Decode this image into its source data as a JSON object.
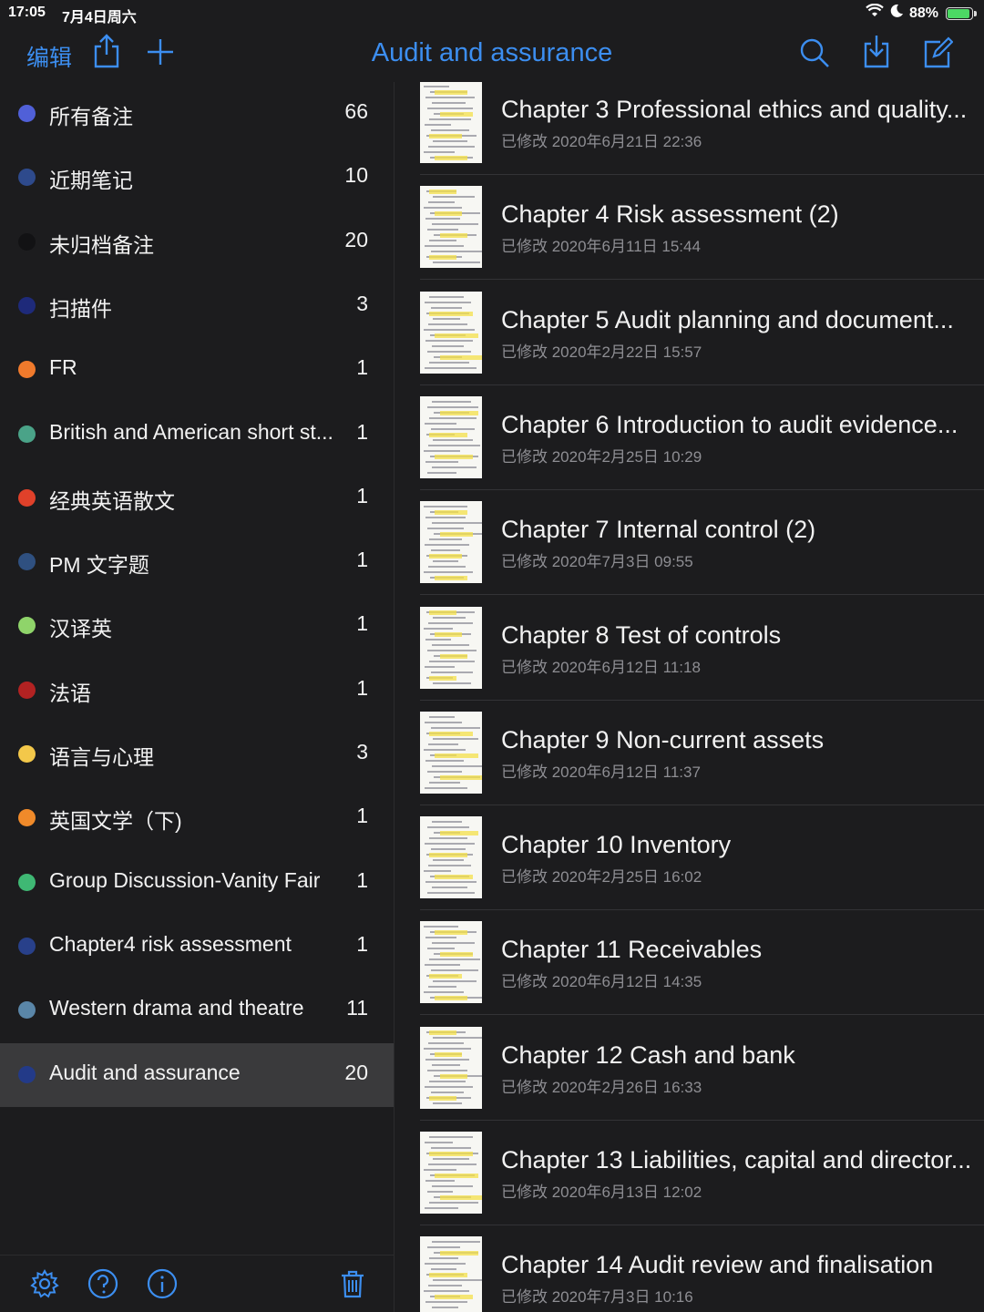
{
  "status_bar": {
    "time": "17:05",
    "date": "7月4日周六",
    "battery": "88%"
  },
  "toolbar": {
    "edit_label": "编辑",
    "title": "Audit and assurance",
    "accent": "#3c8ef0"
  },
  "sidebar": {
    "notebooks": [
      {
        "label": "所有备注",
        "count": "66",
        "color": "#5060d8"
      },
      {
        "label": "近期笔记",
        "count": "10",
        "color": "#2e4a8c"
      },
      {
        "label": "未归档备注",
        "count": "20",
        "color": "#121214"
      },
      {
        "label": "扫描件",
        "count": "3",
        "color": "#1e2a7a"
      },
      {
        "label": "FR",
        "count": "1",
        "color": "#f07a2c"
      },
      {
        "label": "British and American short st...",
        "count": "1",
        "color": "#4aa388"
      },
      {
        "label": "经典英语散文",
        "count": "1",
        "color": "#e0412a"
      },
      {
        "label": "PM 文字题",
        "count": "1",
        "color": "#2f5080"
      },
      {
        "label": "汉译英",
        "count": "1",
        "color": "#8fd46a"
      },
      {
        "label": "法语",
        "count": "1",
        "color": "#b22222"
      },
      {
        "label": "语言与心理",
        "count": "3",
        "color": "#f3c84a"
      },
      {
        "label": "英国文学（下)",
        "count": "1",
        "color": "#f08a2a"
      },
      {
        "label": "Group Discussion-Vanity Fair",
        "count": "1",
        "color": "#3fb874"
      },
      {
        "label": "Chapter4 risk assessment",
        "count": "1",
        "color": "#28408a"
      },
      {
        "label": "Western drama and theatre",
        "count": "11",
        "color": "#5a86a8"
      },
      {
        "label": "Audit and assurance",
        "count": "20",
        "color": "#233a88",
        "selected": true
      }
    ]
  },
  "notes": [
    {
      "title": "Chapter 3 Professional ethics and quality...",
      "meta": "已修改 2020年6月21日 22:36"
    },
    {
      "title": "Chapter 4 Risk assessment  (2)",
      "meta": "已修改 2020年6月11日 15:44"
    },
    {
      "title": "Chapter 5 Audit planning and document...",
      "meta": "已修改 2020年2月22日 15:57"
    },
    {
      "title": "Chapter 6 Introduction to audit evidence...",
      "meta": "已修改 2020年2月25日 10:29"
    },
    {
      "title": "Chapter 7 Internal control  (2)",
      "meta": "已修改 2020年7月3日 09:55"
    },
    {
      "title": "Chapter 8 Test of controls",
      "meta": "已修改 2020年6月12日 11:18"
    },
    {
      "title": "Chapter 9 Non-current assets",
      "meta": "已修改 2020年6月12日 11:37"
    },
    {
      "title": "Chapter 10 Inventory",
      "meta": "已修改 2020年2月25日 16:02"
    },
    {
      "title": "Chapter 11 Receivables",
      "meta": "已修改 2020年6月12日 14:35"
    },
    {
      "title": "Chapter 12 Cash and bank",
      "meta": "已修改 2020年2月26日 16:33"
    },
    {
      "title": "Chapter 13 Liabilities, capital and director...",
      "meta": "已修改 2020年6月13日 12:02"
    },
    {
      "title": "Chapter 14 Audit review and finalisation",
      "meta": "已修改 2020年7月3日 10:16"
    }
  ]
}
